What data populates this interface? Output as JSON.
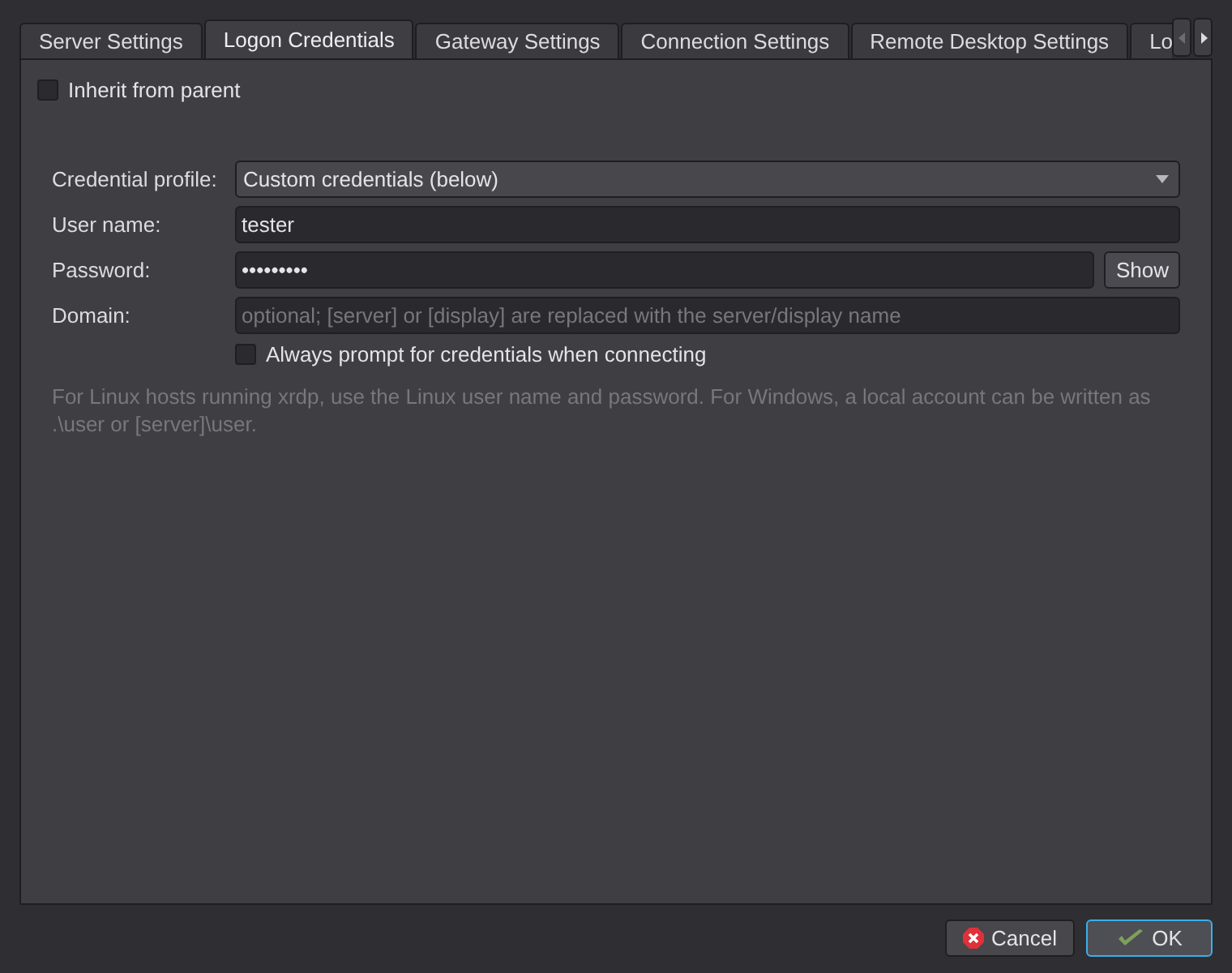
{
  "tabs": [
    {
      "label": "Server Settings",
      "selected": false
    },
    {
      "label": "Logon Credentials",
      "selected": true
    },
    {
      "label": "Gateway Settings",
      "selected": false
    },
    {
      "label": "Connection Settings",
      "selected": false
    },
    {
      "label": "Remote Desktop Settings",
      "selected": false
    },
    {
      "label": "Lo",
      "selected": false
    }
  ],
  "inherit": {
    "label": "Inherit from parent",
    "checked": false
  },
  "form": {
    "credential_profile": {
      "label": "Credential profile:",
      "value": "Custom credentials (below)"
    },
    "user_name": {
      "label": "User name:",
      "value": "tester"
    },
    "password": {
      "label": "Password:",
      "value": "•••••••••",
      "button": "Show"
    },
    "domain": {
      "label": "Domain:",
      "placeholder": "optional; [server] or [display] are replaced with the server/display name"
    },
    "always_prompt": {
      "label": "Always prompt for credentials when connecting",
      "checked": false
    }
  },
  "help_text": "For Linux hosts running xrdp, use the Linux user name and password. For Windows, a local account can be written as .\\user or [server]\\user.",
  "buttons": [
    {
      "label": "Cancel",
      "kind": "cancel",
      "default": false
    },
    {
      "label": "OK",
      "kind": "ok",
      "default": true
    }
  ]
}
